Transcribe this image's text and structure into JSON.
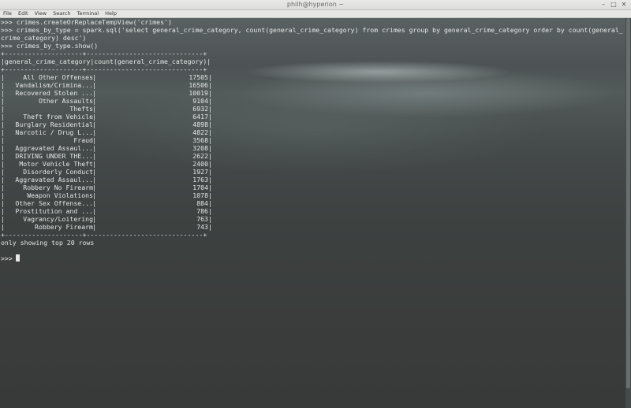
{
  "window": {
    "title": "philh@hyperion ~"
  },
  "menu": [
    "File",
    "Edit",
    "View",
    "Search",
    "Terminal",
    "Help"
  ],
  "terminal": {
    "commands": [
      ">>> crimes.createOrReplaceTempView('crimes')",
      ">>> crimes_by_type = spark.sql('select general_crime_category, count(general_crime_category) from crimes group by general_crime_category order by count(general_",
      "crime_category) desc')",
      ">>> crimes_by_type.show()"
    ],
    "table_border": "+--------------------+------------------------------+",
    "table_header_line": "|general_crime_category|count(general_crime_category)|",
    "rows": [
      {
        "name": "All Other Offenses",
        "count": "17505"
      },
      {
        "name": "Vandalism/Crimina...",
        "count": "16506"
      },
      {
        "name": "Recovered Stolen ...",
        "count": "10019"
      },
      {
        "name": "Other Assaults",
        "count": "9104"
      },
      {
        "name": "Thefts",
        "count": "6932"
      },
      {
        "name": "Theft from Vehicle",
        "count": "6417"
      },
      {
        "name": "Burglary Residential",
        "count": "4898"
      },
      {
        "name": "Narcotic / Drug L...",
        "count": "4822"
      },
      {
        "name": "Fraud",
        "count": "3568"
      },
      {
        "name": "Aggravated Assaul...",
        "count": "3208"
      },
      {
        "name": "DRIVING UNDER THE...",
        "count": "2622"
      },
      {
        "name": "Motor Vehicle Theft",
        "count": "2400"
      },
      {
        "name": "Disorderly Conduct",
        "count": "1927"
      },
      {
        "name": "Aggravated Assaul...",
        "count": "1763"
      },
      {
        "name": "Robbery No Firearm",
        "count": "1704"
      },
      {
        "name": "Weapon Violations",
        "count": "1078"
      },
      {
        "name": "Other Sex Offense...",
        "count": "884"
      },
      {
        "name": "Prostitution and ...",
        "count": "786"
      },
      {
        "name": "Vagrancy/Loitering",
        "count": "763"
      },
      {
        "name": "Robbery Firearm",
        "count": "743"
      }
    ],
    "footer": "only showing top 20 rows",
    "prompt": ">>> "
  }
}
